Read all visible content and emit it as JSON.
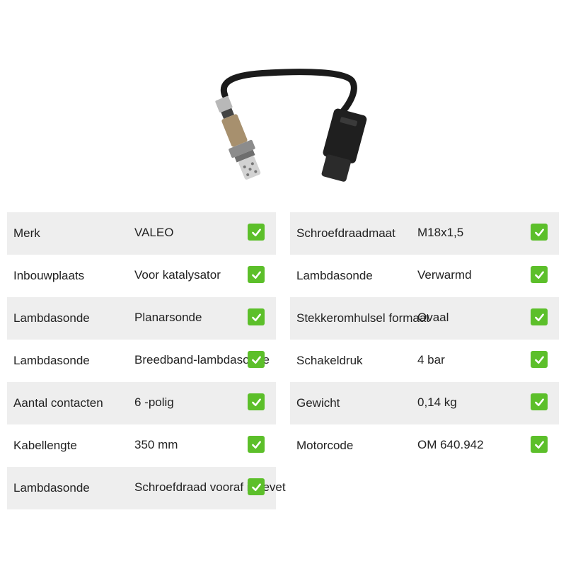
{
  "icon": "check-mark-icon",
  "colors": {
    "check": "#5cbf2a",
    "row_shade": "#eeeeee"
  },
  "specs_left": [
    {
      "label": "Merk",
      "value": "VALEO"
    },
    {
      "label": "Inbouwplaats",
      "value": "Voor katalysator"
    },
    {
      "label": "Lambdasonde",
      "value": "Planarsonde"
    },
    {
      "label": "Lambdasonde",
      "value": "Breedband-lambdasonde"
    },
    {
      "label": "Aantal contacten",
      "value": "6 -polig"
    },
    {
      "label": "Kabellengte",
      "value": "350 mm"
    },
    {
      "label": "Lambdasonde",
      "value": "Schroefdraad vooraf ingevet"
    }
  ],
  "specs_right": [
    {
      "label": "Schroefdraadmaat",
      "value": "M18x1,5"
    },
    {
      "label": "Lambdasonde",
      "value": "Verwarmd"
    },
    {
      "label": "Stekkeromhulsel formaat",
      "value": "Ovaal"
    },
    {
      "label": "Schakeldruk",
      "value": "4 bar"
    },
    {
      "label": "Gewicht",
      "value": "0,14 kg"
    },
    {
      "label": "Motorcode",
      "value": "OM 640.942"
    }
  ]
}
